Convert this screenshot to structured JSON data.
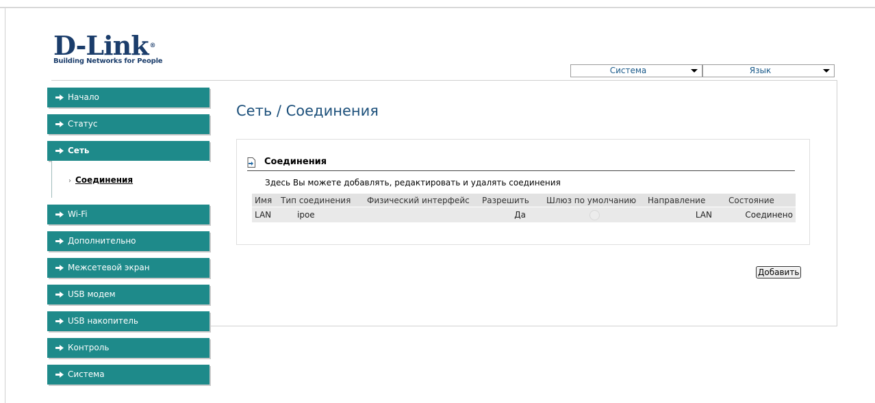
{
  "logo": {
    "name": "D-Link",
    "reg": "®",
    "tagline": "Building Networks for People"
  },
  "top_selects": {
    "system": "Система",
    "language": "Язык"
  },
  "sidebar": {
    "items": [
      {
        "label": "Начало"
      },
      {
        "label": "Статус"
      },
      {
        "label": "Сеть",
        "active": true
      },
      {
        "label": "Wi-Fi"
      },
      {
        "label": "Дополнительно"
      },
      {
        "label": "Межсетевой экран"
      },
      {
        "label": "USB модем"
      },
      {
        "label": "USB накопитель"
      },
      {
        "label": "Контроль"
      },
      {
        "label": "Система"
      }
    ],
    "sub_item": {
      "marker": "›",
      "label": "Соединения"
    }
  },
  "main": {
    "title": "Сеть / Соединения",
    "section_title": "Соединения",
    "description": "Здесь Вы можете добавлять, редактировать и удалять соединения",
    "table": {
      "headers": [
        "Имя",
        "Тип соединения",
        "Физический интерфейс",
        "Разрешить",
        "Шлюз по умолчанию",
        "Направление",
        "Состояние"
      ],
      "rows": [
        {
          "name": "LAN",
          "type": "ipoe",
          "interface": "",
          "enabled": "Да",
          "direction": "LAN",
          "status": "Соединено"
        }
      ]
    },
    "add_button": "Добавить"
  },
  "colors": {
    "nav_bg": "#1e8a8a",
    "title": "#1b4f7a",
    "logo": "#1b3d6b"
  }
}
